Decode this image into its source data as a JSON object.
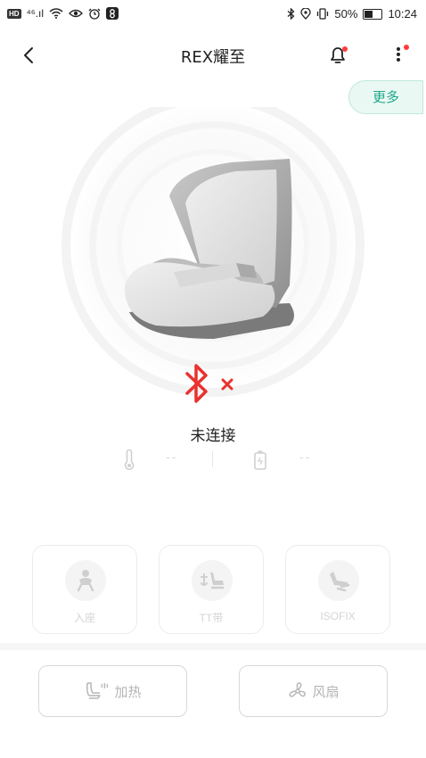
{
  "status_bar": {
    "hd": "HD",
    "signal": "⁴⁶.ıl",
    "battery_percent": "50%",
    "battery_level": 0.5,
    "time": "10:24"
  },
  "header": {
    "title": "REX耀至"
  },
  "more_button": {
    "label": "更多"
  },
  "device": {
    "connection_status": "未连接",
    "temperature": "--",
    "battery": "--"
  },
  "tiles": [
    {
      "label": "入座"
    },
    {
      "label": "TT带"
    },
    {
      "label": "ISOFIX"
    }
  ],
  "controls": {
    "heat_label": "加热",
    "fan_label": "风扇"
  },
  "colors": {
    "accent": "#1fa88a",
    "alert": "#e8322f",
    "disabled": "#d4d4d4"
  }
}
